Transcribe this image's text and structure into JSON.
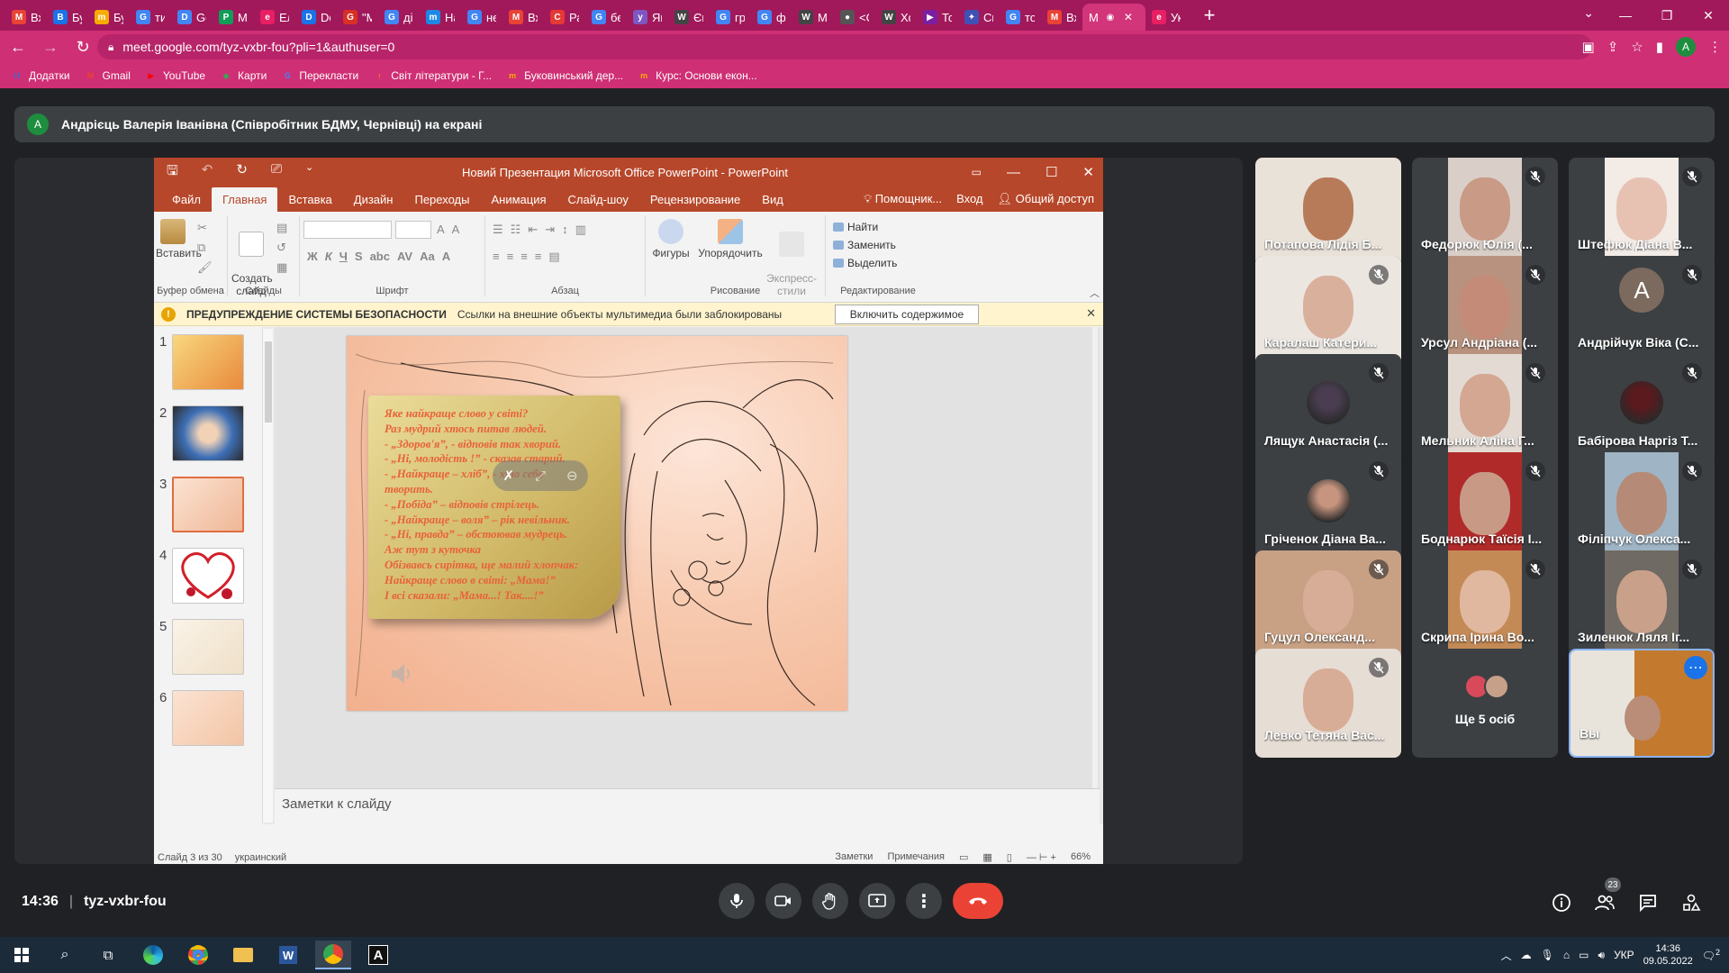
{
  "browser": {
    "tabs": [
      {
        "label": "Вхі",
        "fav": "M",
        "color": "#ea4335"
      },
      {
        "label": "Бук",
        "fav": "B",
        "color": "#1a73e8"
      },
      {
        "label": "Бук",
        "fav": "m",
        "color": "#f9ab00"
      },
      {
        "label": "тир",
        "fav": "G",
        "color": "#4285f4"
      },
      {
        "label": "Go",
        "fav": "D",
        "color": "#4285f4"
      },
      {
        "label": "Ма",
        "fav": "P",
        "color": "#0f9d58"
      },
      {
        "label": "Еле",
        "fav": "e",
        "color": "#e91e63"
      },
      {
        "label": "Do",
        "fav": "D",
        "color": "#1a73e8"
      },
      {
        "label": "\"М",
        "fav": "G",
        "color": "#d93025"
      },
      {
        "label": "діа",
        "fav": "G",
        "color": "#4285f4"
      },
      {
        "label": "На",
        "fav": "m",
        "color": "#1e88e5"
      },
      {
        "label": "ней",
        "fav": "G",
        "color": "#4285f4"
      },
      {
        "label": "Вхі",
        "fav": "M",
        "color": "#ea4335"
      },
      {
        "label": "Рас",
        "fav": "C",
        "color": "#e53935"
      },
      {
        "label": "бес",
        "fav": "G",
        "color": "#4285f4"
      },
      {
        "label": "Які",
        "fav": "y",
        "color": "#7e57c2"
      },
      {
        "label": "Єщ",
        "fav": "W",
        "color": "#444444"
      },
      {
        "label": "гри",
        "fav": "G",
        "color": "#4285f4"
      },
      {
        "label": "фе",
        "fav": "G",
        "color": "#4285f4"
      },
      {
        "label": "Ме",
        "fav": "W",
        "color": "#444444"
      },
      {
        "label": "<С",
        "fav": "●",
        "color": "#555555"
      },
      {
        "label": "Хо",
        "fav": "W",
        "color": "#444444"
      },
      {
        "label": "Тог",
        "fav": "▶",
        "color": "#7b1fa2"
      },
      {
        "label": "Спі",
        "fav": "✦",
        "color": "#3f51b5"
      },
      {
        "label": "тов",
        "fav": "G",
        "color": "#4285f4"
      },
      {
        "label": "Вхі",
        "fav": "M",
        "color": "#ea4335"
      }
    ],
    "active_tab": {
      "label": "М",
      "fav": "◉"
    },
    "last_tab": {
      "label": "Укр",
      "fav": "e",
      "color": "#e91e63"
    },
    "url": "meet.google.com/tyz-vxbr-fou?pli=1&authuser=0",
    "profile_letter": "A",
    "bookmarks": [
      {
        "label": "Додатки",
        "fav": "⁝⁝",
        "color": "#1a73e8"
      },
      {
        "label": "Gmail",
        "fav": "M",
        "color": "#ea4335"
      },
      {
        "label": "YouTube",
        "fav": "▶",
        "color": "#ff0000"
      },
      {
        "label": "Карти",
        "fav": "◆",
        "color": "#34a853"
      },
      {
        "label": "Перекласти",
        "fav": "G",
        "color": "#4285f4"
      },
      {
        "label": "Світ літератури - Г...",
        "fav": "↑",
        "color": "#f9ab00"
      },
      {
        "label": "Буковинський дер...",
        "fav": "m",
        "color": "#f9ab00"
      },
      {
        "label": "Курс: Основи екон...",
        "fav": "m",
        "color": "#f9ab00"
      }
    ]
  },
  "meet": {
    "presenter_letter": "A",
    "presenter_banner": "Андрієць Валерія Іванівна (Співробітник БДМУ, Чернівці) на екрані",
    "time": "14:36",
    "code": "tyz-vxbr-fou",
    "people_count": "23",
    "participants": [
      {
        "name": "Потапова Лідія Б...",
        "muted": false,
        "tone": "#b87b5a",
        "bg": "#e9e2d9"
      },
      {
        "name": "Федорюк Юлія (...",
        "muted": true,
        "tone": "#c99a86",
        "bg": "#d9cfc8"
      },
      {
        "name": "Штефюк Діана В...",
        "muted": true,
        "tone": "#e7c2b3",
        "bg": "#f2ebe6"
      },
      {
        "name": "Каралаш Катери...",
        "muted": true,
        "tone": "#d9b09c",
        "bg": "#ece6e1"
      },
      {
        "name": "Урсул Андріана (...",
        "muted": true,
        "tone": "#c38b78",
        "bg": "#b9927f"
      },
      {
        "name": "Андрійчук Віка (С...",
        "muted": true,
        "letter": "A"
      },
      {
        "name": "Лящук Анастасія (...",
        "muted": true,
        "avatar": true,
        "tone": "#4a3d52"
      },
      {
        "name": "Мельник Аліна Г...",
        "muted": true,
        "tone": "#d3a792",
        "bg": "#e3dbd3"
      },
      {
        "name": "Бабірова Наргіз Т...",
        "muted": true,
        "avatar": true,
        "tone": "#5a1a1e"
      },
      {
        "name": "Гріченок Діана Ва...",
        "muted": true,
        "avatar": true,
        "tone": "#c7957f"
      },
      {
        "name": "Боднарюк Таїсія І...",
        "muted": true,
        "tone": "#c89a86",
        "bg": "#b12a2a"
      },
      {
        "name": "Філіпчук Олекса...",
        "muted": true,
        "tone": "#b58b77",
        "bg": "#9fb4c4"
      },
      {
        "name": "Гуцул Олександ...",
        "muted": true,
        "tone": "#d8ad97",
        "bg": "#c8a184"
      },
      {
        "name": "Скрипа Ірина Во...",
        "muted": true,
        "tone": "#e0b89f",
        "bg": "#c48a56"
      },
      {
        "name": "Зиленюк Ляля Іг...",
        "muted": true,
        "tone": "#c9a08a",
        "bg": "#6f6a63"
      },
      {
        "name": "Левко Тетяна Вас...",
        "muted": true,
        "tone": "#d8ad97",
        "bg": "#e6ddd5"
      }
    ],
    "others_label": "Ще 5 осіб",
    "self_label": "Вы"
  },
  "powerpoint": {
    "title": "Новий Презентация Microsoft Office PowerPoint - PowerPoint",
    "menu": [
      "Файл",
      "Главная",
      "Вставка",
      "Дизайн",
      "Переходы",
      "Анимация",
      "Слайд-шоу",
      "Рецензирование",
      "Вид"
    ],
    "active_menu": "Главная",
    "menu_right": {
      "help": "Помощник...",
      "signin": "Вход",
      "share": "Общий доступ"
    },
    "ribbon": {
      "paste": "Вставить",
      "new_slide": "Создать\nслайд",
      "shapes": "Фигуры",
      "arrange": "Упорядочить",
      "quick_styles": "Экспресс-\nстили",
      "find": "Найти",
      "replace": "Заменить",
      "select": "Выделить",
      "groups": [
        "Буфер обмена",
        "Слайды",
        "Шрифт",
        "Абзац",
        "Рисование",
        "Редактирование"
      ]
    },
    "security": {
      "title": "ПРЕДУПРЕЖДЕНИЕ СИСТЕМЫ БЕЗОПАСНОСТИ",
      "message": "Ссылки на внешние объекты мультимедиа были заблокированы",
      "button": "Включить содержимое"
    },
    "thumbnails": [
      "1",
      "2",
      "3",
      "4",
      "5",
      "6"
    ],
    "selected_slide": 3,
    "poem_lines": [
      "Яке найкраще слово у світі?",
      "Раз мудрий хтось питав людей.",
      "- „Здоров'я”, - відповів так хворий.",
      "- „Ні, молодість !” - сказав старий.",
      "- „Найкраще – хліб”, - хто себе",
      "творить.",
      "- „Побіда” – відповів стрілець.",
      "- „Найкраще – воля” – рік невільник.",
      "- „Ні, правда” – обстоював мудрець.",
      "Аж тут з куточка",
      "Обізвавсь сирітка, ще малий хлопчак:",
      "Найкраще слово в світі: „Мама!”",
      "І всі сказали: „Мама...! Так....!”"
    ],
    "notes_placeholder": "Заметки к слайду",
    "status": {
      "slide_of": "Слайд 3 из 30",
      "language": "украинский",
      "notes": "Заметки",
      "comments": "Примечания",
      "zoom": "66%"
    }
  },
  "taskbar": {
    "lang": "УКР",
    "time": "14:36",
    "date": "09.05.2022",
    "notifications": "2"
  }
}
